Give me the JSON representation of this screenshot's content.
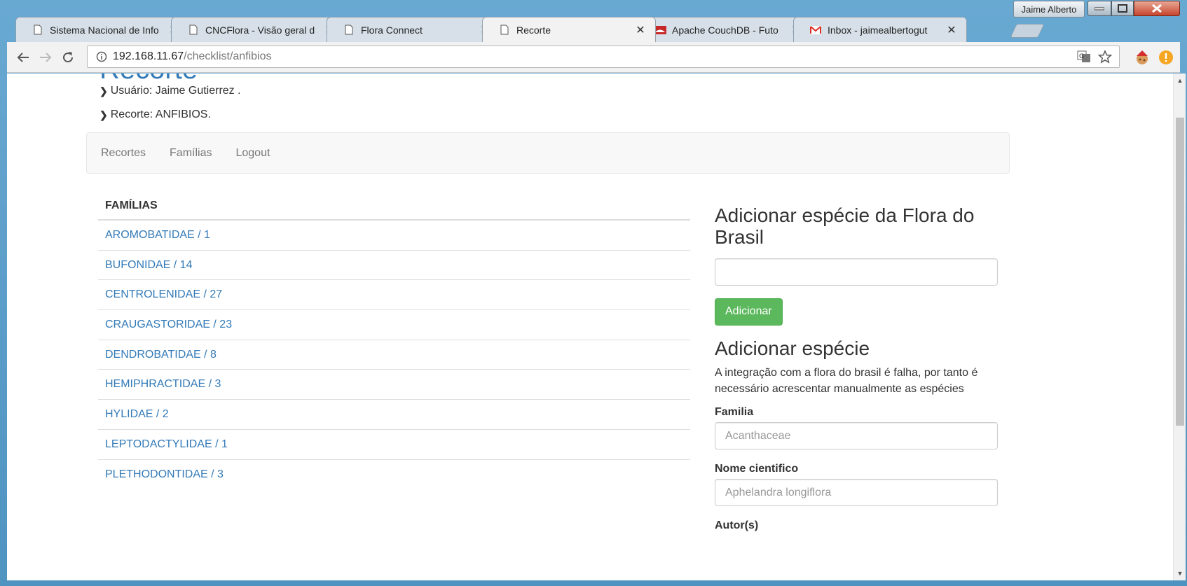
{
  "window": {
    "profile_name": "Jaime Alberto"
  },
  "tabs": [
    {
      "title": "Sistema Nacional de Info",
      "icon": "page-icon"
    },
    {
      "title": "CNCFlora - Visão geral d",
      "icon": "page-icon"
    },
    {
      "title": "Flora Connect",
      "icon": "page-icon"
    },
    {
      "title": "Recorte",
      "icon": "page-icon",
      "active": true
    },
    {
      "title": "Apache CouchDB - Futo",
      "icon": "couchdb-icon"
    },
    {
      "title": "Inbox - jaimealbertogut",
      "icon": "gmail-icon"
    }
  ],
  "address_bar": {
    "host": "192.168.11.67",
    "path": "/checklist/anfibios"
  },
  "page": {
    "title_partial": "Recorte",
    "usuario_line": "Usuário: Jaime Gutierrez .",
    "recorte_line": "Recorte: ANFIBIOS.",
    "nav": [
      "Recortes",
      "Famílias",
      "Logout"
    ],
    "families_header": "FAMÍLIAS",
    "families": [
      "AROMOBATIDAE / 1",
      "BUFONIDAE / 14",
      "CENTROLENIDAE / 27",
      "CRAUGASTORIDAE / 23",
      "DENDROBATIDAE / 8",
      "HEMIPHRACTIDAE / 3",
      "HYLIDAE / 2",
      "LEPTODACTYLIDAE / 1",
      "PLETHODONTIDAE / 3"
    ],
    "add_flora": {
      "heading": "Adicionar espécie da Flora do Brasil",
      "input_value": "",
      "button": "Adicionar"
    },
    "add_species": {
      "heading": "Adicionar espécie",
      "description": "A integração com a flora do brasil é falha, por tanto é necessário acrescentar manualmente as espécies",
      "familia_label": "Familia",
      "familia_placeholder": "Acanthaceae",
      "nome_label": "Nome cientifico",
      "nome_placeholder": "Aphelandra longiflora",
      "autor_label": "Autor(s)"
    }
  }
}
